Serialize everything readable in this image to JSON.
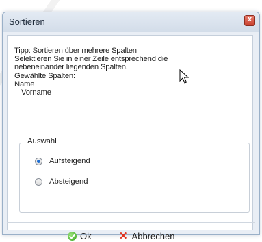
{
  "window": {
    "title": "Sortieren",
    "close_glyph": "x"
  },
  "info": {
    "line1": "Tipp: Sortieren über mehrere Spalten",
    "line2": "Selektieren Sie in einer Zeile entsprechend die",
    "line3": "nebeneinander liegenden Spalten.",
    "line4": "Gewählte Spalten:",
    "columns": [
      "Name",
      "Vorname"
    ]
  },
  "group": {
    "label": "Auswahl",
    "options": [
      {
        "label": "Aufsteigend",
        "checked": true
      },
      {
        "label": "Absteigend",
        "checked": false
      }
    ]
  },
  "buttons": {
    "ok": "Ok",
    "cancel": "Abbrechen",
    "cancel_glyph": "✕"
  },
  "icons": {
    "ok_icon": "green-check-circle",
    "cancel_icon": "red-x",
    "cursor": "arrow-cursor"
  },
  "colors": {
    "ok_green": "#35a51c",
    "cancel_red": "#e2321e",
    "radio_selected": "#1f6fd4"
  }
}
